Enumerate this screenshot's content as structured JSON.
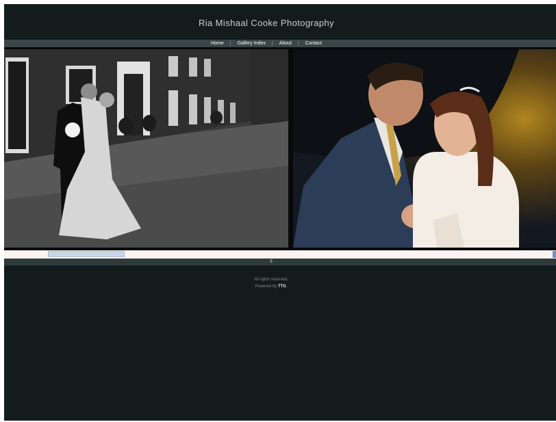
{
  "site": {
    "title": "Ria Mishaal Cooke Photography"
  },
  "nav": {
    "items": [
      {
        "label": "Home"
      },
      {
        "label": "Gallery Index"
      },
      {
        "label": "About"
      },
      {
        "label": "Contact"
      }
    ],
    "separator": "|"
  },
  "gallery": {
    "page_number": "5"
  },
  "footer": {
    "rights": "All rights reserved.",
    "powered_prefix": "Powered by",
    "powered_brand": "TTG",
    "powered_suffix": "."
  },
  "colors": {
    "background": "#141b1d",
    "nav_bar": "#3a4648",
    "filmstrip": "#fbf3f1",
    "thumb_highlight": "#c8d6ea"
  }
}
